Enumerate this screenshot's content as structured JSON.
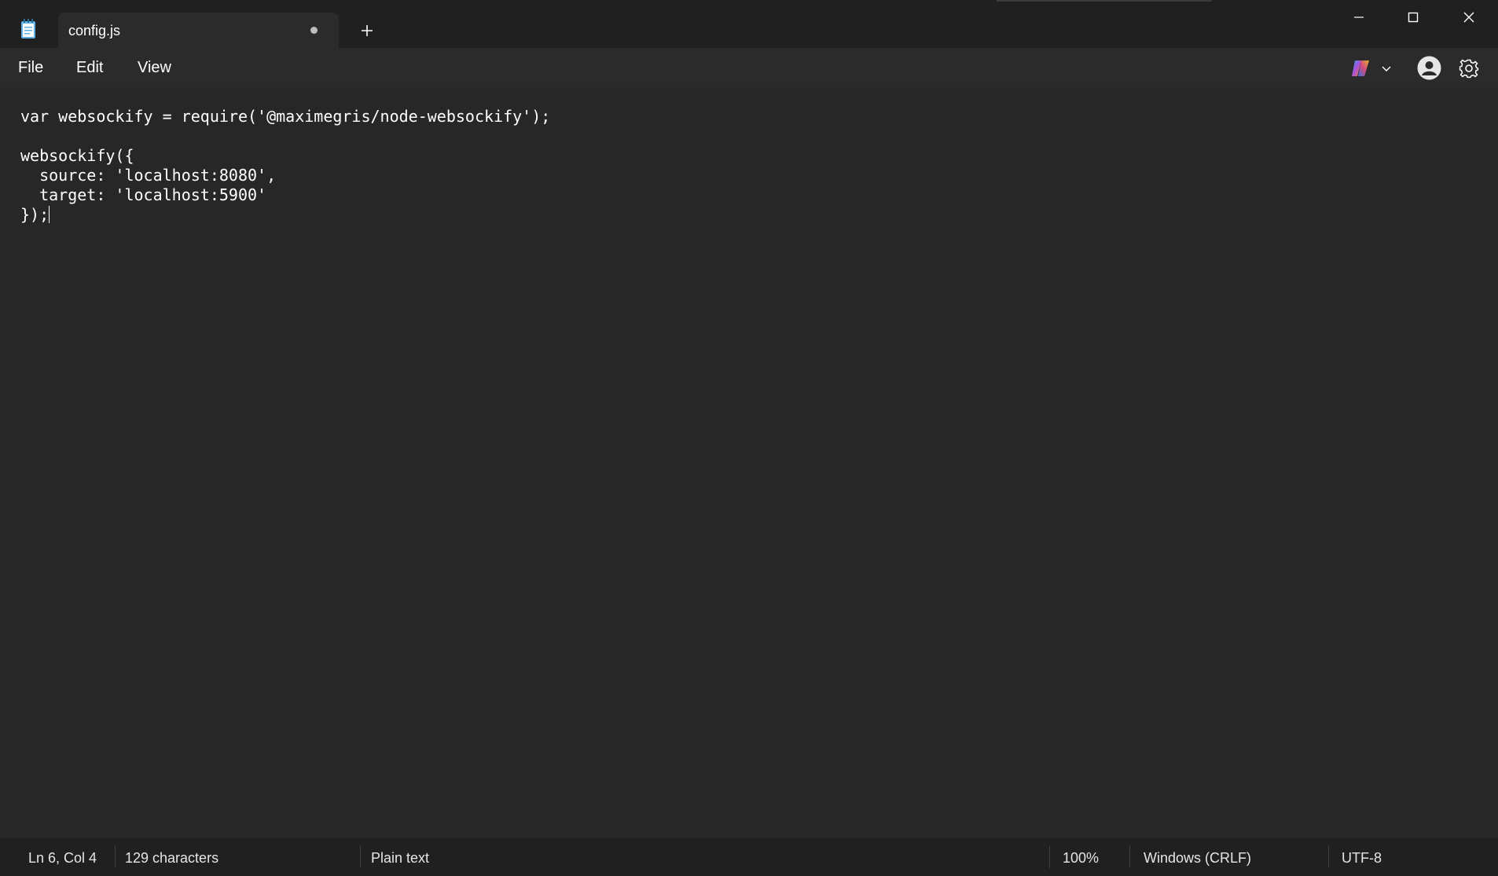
{
  "window": {
    "tab_title": "config.js",
    "new_tab_symbol": "+"
  },
  "menu": {
    "file": "File",
    "edit": "Edit",
    "view": "View"
  },
  "editor": {
    "lines": [
      "var websockify = require('@maximegris/node-websockify');",
      "",
      "websockify({",
      "  source: 'localhost:8080',",
      "  target: 'localhost:5900'",
      "});"
    ]
  },
  "status": {
    "position": "Ln 6, Col 4",
    "characters": "129 characters",
    "language": "Plain text",
    "zoom": "100%",
    "line_ending": "Windows (CRLF)",
    "encoding": "UTF-8"
  },
  "icons": {
    "app": "notepad-icon",
    "tab_unsaved": "unsaved-dot-icon",
    "new_tab": "plus-icon",
    "minimize": "minimize-icon",
    "maximize": "maximize-icon",
    "close": "close-icon",
    "copilot": "copilot-icon",
    "chevron": "chevron-down-icon",
    "account": "account-icon",
    "settings": "gear-icon"
  },
  "colors": {
    "background": "#272727",
    "titlebar": "#202020",
    "menubar": "#2b2b2b",
    "text": "#ffffff"
  }
}
